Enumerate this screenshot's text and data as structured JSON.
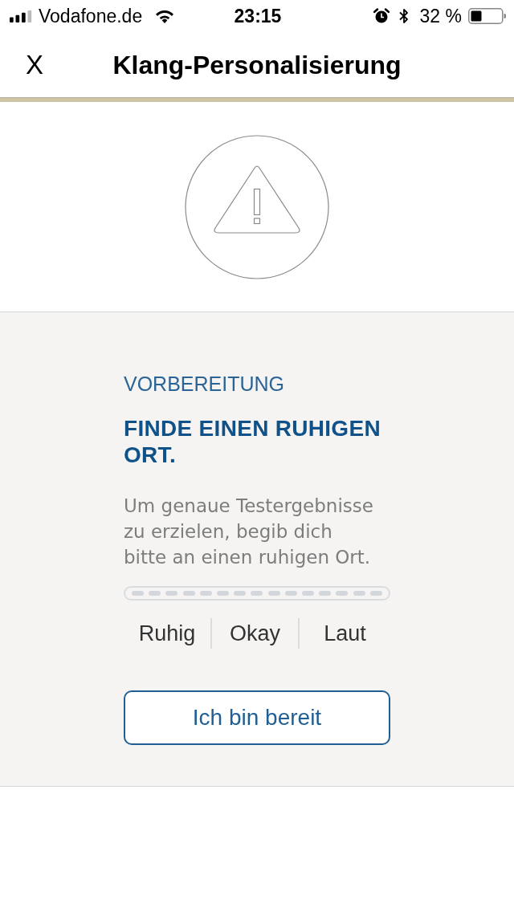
{
  "status_bar": {
    "carrier": "Vodafone.de",
    "time": "23:15",
    "battery": "32 %"
  },
  "nav": {
    "close": "X",
    "title": "Klang-Personalisierung"
  },
  "step": {
    "eyebrow": "VORBEREITUNG",
    "heading": "FINDE EINEN RUHIGEN ORT.",
    "body": "Um genaue Testergebnisse zu erzielen, begib dich bitte an einen ruhigen Ort."
  },
  "noise_meter": {
    "level": 0
  },
  "noise_labels": [
    "Ruhig",
    "Okay",
    "Laut"
  ],
  "button": "Ich bin bereit"
}
